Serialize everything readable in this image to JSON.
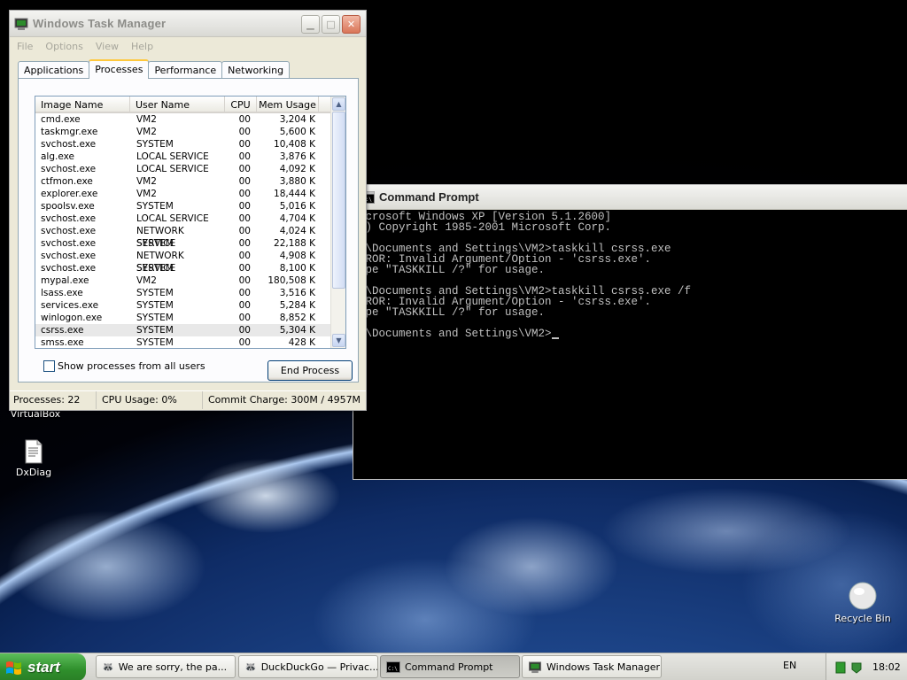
{
  "desktop": {
    "icons": [
      {
        "label": "VirtualBox"
      },
      {
        "label": "DxDiag"
      },
      {
        "label": "Recycle Bin"
      }
    ]
  },
  "taskmgr": {
    "title": "Windows Task Manager",
    "menu": [
      "File",
      "Options",
      "View",
      "Help"
    ],
    "tabs": [
      "Applications",
      "Processes",
      "Performance",
      "Networking"
    ],
    "active_tab": "Processes",
    "columns": [
      "Image Name",
      "User Name",
      "CPU",
      "Mem Usage"
    ],
    "processes": [
      {
        "name": "cmd.exe",
        "user": "VM2",
        "cpu": "00",
        "mem": "3,204 K"
      },
      {
        "name": "taskmgr.exe",
        "user": "VM2",
        "cpu": "00",
        "mem": "5,600 K"
      },
      {
        "name": "svchost.exe",
        "user": "SYSTEM",
        "cpu": "00",
        "mem": "10,408 K"
      },
      {
        "name": "alg.exe",
        "user": "LOCAL SERVICE",
        "cpu": "00",
        "mem": "3,876 K"
      },
      {
        "name": "svchost.exe",
        "user": "LOCAL SERVICE",
        "cpu": "00",
        "mem": "4,092 K"
      },
      {
        "name": "ctfmon.exe",
        "user": "VM2",
        "cpu": "00",
        "mem": "3,880 K"
      },
      {
        "name": "explorer.exe",
        "user": "VM2",
        "cpu": "00",
        "mem": "18,444 K"
      },
      {
        "name": "spoolsv.exe",
        "user": "SYSTEM",
        "cpu": "00",
        "mem": "5,016 K"
      },
      {
        "name": "svchost.exe",
        "user": "LOCAL SERVICE",
        "cpu": "00",
        "mem": "4,704 K"
      },
      {
        "name": "svchost.exe",
        "user": "NETWORK SERVICE",
        "cpu": "00",
        "mem": "4,024 K"
      },
      {
        "name": "svchost.exe",
        "user": "SYSTEM",
        "cpu": "00",
        "mem": "22,188 K"
      },
      {
        "name": "svchost.exe",
        "user": "NETWORK SERVICE",
        "cpu": "00",
        "mem": "4,908 K"
      },
      {
        "name": "svchost.exe",
        "user": "SYSTEM",
        "cpu": "00",
        "mem": "8,100 K"
      },
      {
        "name": "mypal.exe",
        "user": "VM2",
        "cpu": "00",
        "mem": "180,508 K"
      },
      {
        "name": "lsass.exe",
        "user": "SYSTEM",
        "cpu": "00",
        "mem": "3,516 K"
      },
      {
        "name": "services.exe",
        "user": "SYSTEM",
        "cpu": "00",
        "mem": "5,284 K"
      },
      {
        "name": "winlogon.exe",
        "user": "SYSTEM",
        "cpu": "00",
        "mem": "8,852 K"
      },
      {
        "name": "csrss.exe",
        "user": "SYSTEM",
        "cpu": "00",
        "mem": "5,304 K",
        "selected": true
      },
      {
        "name": "smss.exe",
        "user": "SYSTEM",
        "cpu": "00",
        "mem": "428 K"
      }
    ],
    "show_all_label": "Show processes from all users",
    "end_process_label": "End Process",
    "status": {
      "processes": "Processes: 22",
      "cpu": "CPU Usage: 0%",
      "commit": "Commit Charge: 300M / 4957M"
    }
  },
  "cmd": {
    "title": "Command Prompt",
    "lines": [
      "icrosoft Windows XP [Version 5.1.2600]",
      "C) Copyright 1985-2001 Microsoft Corp.",
      "",
      ":\\Documents and Settings\\VM2>taskkill csrss.exe",
      "RROR: Invalid Argument/Option - 'csrss.exe'.",
      "ype \"TASKKILL /?\" for usage.",
      "",
      ":\\Documents and Settings\\VM2>taskkill csrss.exe /f",
      "RROR: Invalid Argument/Option - 'csrss.exe'.",
      "ype \"TASKKILL /?\" for usage.",
      ""
    ],
    "prompt": ":\\Documents and Settings\\VM2>"
  },
  "taskbar": {
    "start_label": "start",
    "tasks": [
      {
        "label": "We are sorry, the pa...",
        "icon": "browser-icon"
      },
      {
        "label": "DuckDuckGo — Privac...",
        "icon": "browser-icon"
      },
      {
        "label": "Command Prompt",
        "icon": "cmd-icon",
        "active": true
      },
      {
        "label": "Windows Task Manager",
        "icon": "taskmgr-icon"
      }
    ],
    "language": "EN",
    "clock": "18:02"
  }
}
